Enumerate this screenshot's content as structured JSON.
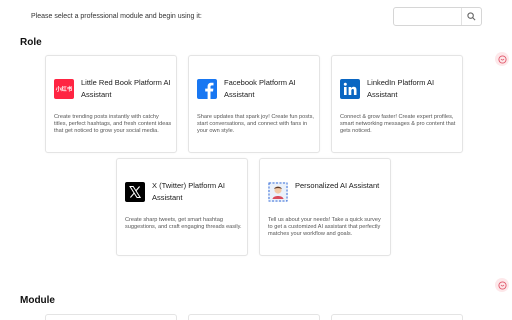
{
  "header": {
    "prompt": "Please select a professional module and begin using it:",
    "search": {
      "placeholder": "",
      "icon": "search-icon"
    }
  },
  "sections": {
    "role": "Role",
    "module": "Module"
  },
  "cards": [
    {
      "title": "Little Red Book Platform AI Assistant",
      "description": "Create trending posts instantly with catchy titles, perfect hashtags, and fresh content ideas that get noticed to grow your social media.",
      "icon": "little-red-book-logo",
      "logo_text": "小红书"
    },
    {
      "title": "Facebook Platform AI Assistant",
      "description": "Share updates that spark joy! Create fun posts, start conversations, and connect with fans in your own style.",
      "icon": "facebook-logo"
    },
    {
      "title": "LinkedIn Platform AI Assistant",
      "description": "Connect & grow faster! Create expert profiles, smart networking messages & pro content that gets noticed.",
      "icon": "linkedin-logo"
    },
    {
      "title": "X (Twitter) Platform AI Assistant",
      "description": "Create sharp tweets, get smart hashtag suggestions, and craft engaging threads easily.",
      "icon": "x-logo"
    },
    {
      "title": "Personalized AI Assistant",
      "description": "Tell us about your needs! Take a quick survey to get a customized AI assistant that perfectly matches your workflow and goals.",
      "icon": "personalized-avatar"
    }
  ],
  "colors": {
    "little_red_book": "#ff2442",
    "facebook": "#1877f2",
    "linkedin": "#0a66c2",
    "x": "#000000",
    "side_button": "#fde8ea"
  }
}
